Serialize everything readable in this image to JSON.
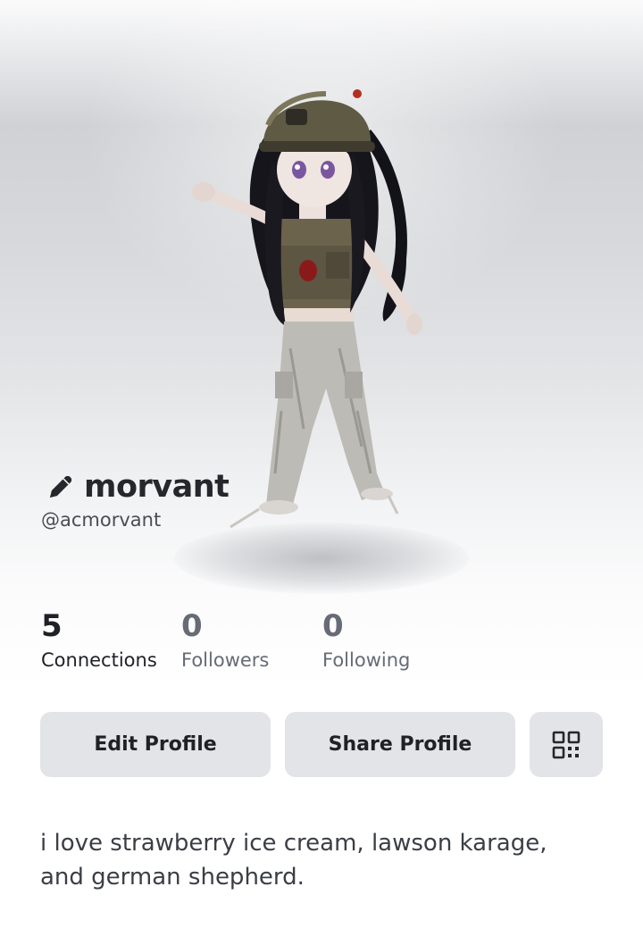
{
  "profile": {
    "display_name": "morvant",
    "username": "@acmorvant",
    "bio": "i love strawberry ice cream, lawson karage, and german shepherd."
  },
  "stats": {
    "connections": {
      "value": "5",
      "label": "Connections"
    },
    "followers": {
      "value": "0",
      "label": "Followers"
    },
    "following": {
      "value": "0",
      "label": "Following"
    }
  },
  "actions": {
    "edit_label": "Edit Profile",
    "share_label": "Share Profile"
  },
  "icons": {
    "edit_name": "pencil-icon",
    "qr": "qr-code-icon"
  },
  "colors": {
    "button_bg": "#e3e4e8",
    "primary_text": "#1f2126",
    "muted_text": "#666b75"
  }
}
